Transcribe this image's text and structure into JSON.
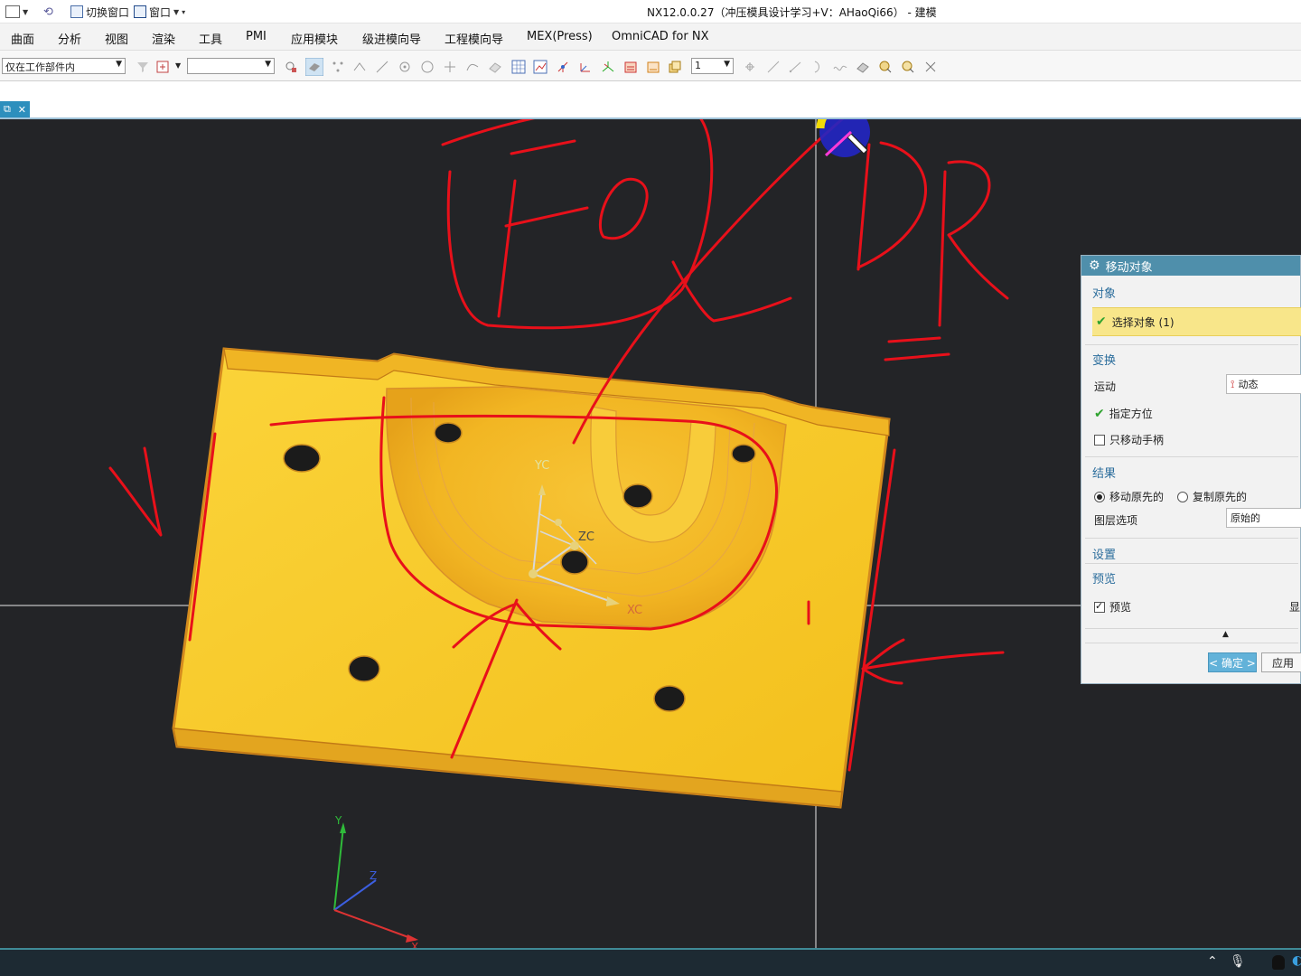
{
  "titlebar": {
    "switch_window": "切换窗口",
    "window_menu": "窗口",
    "title": "NX12.0.0.27（冲压模具设计学习+V：AHaoQi66） - 建模"
  },
  "menu": [
    "曲面",
    "分析",
    "视图",
    "渲染",
    "工具",
    "PMI",
    "应用模块",
    "级进模向导",
    "工程模向导",
    "MEX(Press)",
    "OmniCAD for NX"
  ],
  "toolbar": {
    "selection_scope": "仅在工作部件内",
    "type_filter": "",
    "layer_value": "1"
  },
  "viewport": {
    "wcs_labels": {
      "yc": "YC",
      "zc": "ZC",
      "xc": "XC"
    },
    "abs_axis_labels": {
      "y": "Y",
      "z": "Z",
      "x": "X"
    },
    "colors": {
      "part": "#f8c828",
      "part_edge": "#d48a1e",
      "annotation": "#e8101a",
      "background": "#232427"
    }
  },
  "dialog": {
    "title": "移动对象",
    "section_object": "对象",
    "select_object": "选择对象 (1)",
    "section_transform": "变换",
    "motion_label": "运动",
    "motion_value": "动态",
    "specify_orientation": "指定方位",
    "move_handle_only": "只移动手柄",
    "section_result": "结果",
    "move_original": "移动原先的",
    "copy_original": "复制原先的",
    "layer_option_label": "图层选项",
    "layer_option_value": "原始的",
    "section_settings": "设置",
    "section_preview": "预览",
    "preview_checkbox": "预览",
    "preview_show": "显",
    "ok_button": "< 确定 >",
    "apply_button": "应用"
  }
}
